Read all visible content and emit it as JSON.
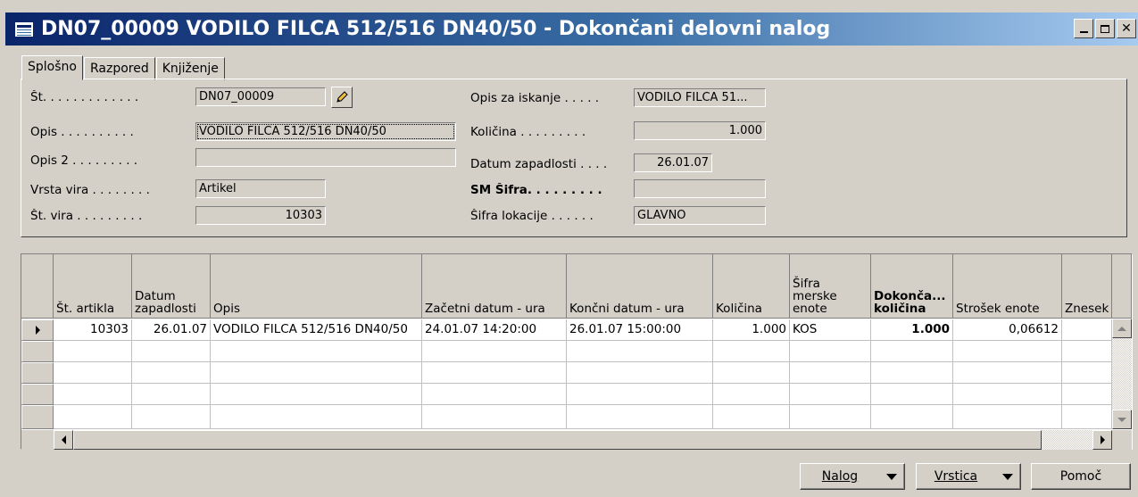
{
  "window": {
    "title": "DN07_00009 VODILO FILCA 512/516 DN40/50 - Dokončani delovni nalog",
    "icon": "form-icon"
  },
  "tabs": [
    {
      "label": "Splošno",
      "active": true
    },
    {
      "label": "Razpored",
      "active": false
    },
    {
      "label": "Knjiženje",
      "active": false
    }
  ],
  "general": {
    "st": {
      "label": "Št. . . . . . . . . . . . .",
      "value": "DN07_00009"
    },
    "opis": {
      "label": "Opis . . . . . . . . . .",
      "value": "VODILO FILCA 512/516 DN40/50"
    },
    "opis2": {
      "label": "Opis 2 . . . . . . . . .",
      "value": ""
    },
    "vrsta_vira": {
      "label": "Vrsta vira . . . . . . . .",
      "value": "Artikel"
    },
    "st_vira": {
      "label": "Št. vira . . . . . . . . .",
      "value": "10303"
    },
    "opis_za_iskanje": {
      "label": "Opis za iskanje . . . . .",
      "value": "VODILO FILCA 51..."
    },
    "kolicina": {
      "label": "Količina . . . . . . . . .",
      "value": "1.000"
    },
    "datum_zapadlosti": {
      "label": "Datum zapadlosti . . . .",
      "value": "26.01.07"
    },
    "sm_sifra": {
      "label": "SM Šifra. . . . . . . . .",
      "value": ""
    },
    "sifra_lokacije": {
      "label": "Šifra lokacije . . . . . .",
      "value": "GLAVNO"
    }
  },
  "lines": {
    "columns": [
      {
        "label": "Št. artikla"
      },
      {
        "label": "Datum zapadlosti"
      },
      {
        "label": "Opis"
      },
      {
        "label": "Začetni datum - ura"
      },
      {
        "label": "Končni datum - ura"
      },
      {
        "label": "Količina"
      },
      {
        "label": "Šifra merske enote"
      },
      {
        "label": "Dokonča... količina"
      },
      {
        "label": "Strošek enote"
      },
      {
        "label": "Znesek"
      }
    ],
    "rows": [
      {
        "st_artikla": "10303",
        "datum_zapadlosti": "26.01.07",
        "opis": "VODILO FILCA 512/516 DN40/50",
        "zacetni": "24.01.07 14:20:00",
        "koncni": "26.01.07 15:00:00",
        "kolicina": "1.000",
        "sifra_me": "KOS",
        "dokoncana_kolicina": "1.000",
        "strosek_enote": "0,06612",
        "znesek": ""
      }
    ]
  },
  "buttons": {
    "nalog": "Nalog",
    "vrstica": "Vrstica",
    "pomoc": "Pomoč"
  }
}
